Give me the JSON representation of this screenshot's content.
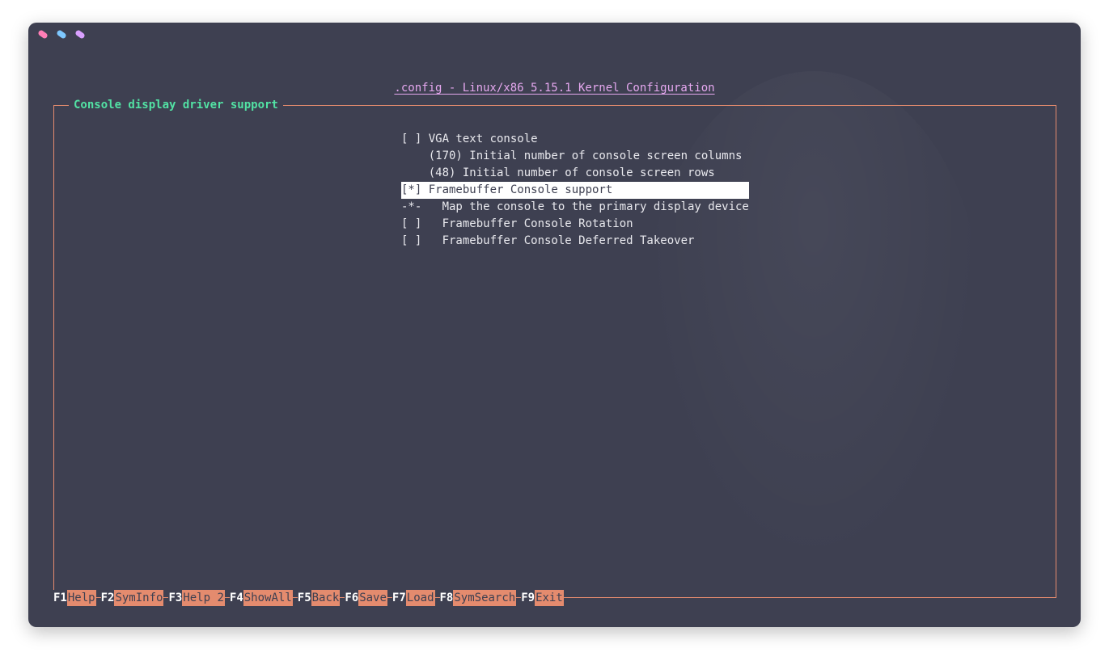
{
  "colors": {
    "window_bg": "#3e4051",
    "accent": "#e48b6e",
    "title_color": "#e6a8f0",
    "frame_title_color": "#52e2a4",
    "text": "#e9e9ee",
    "dot_pink": "#ff7eb6",
    "dot_blue": "#7ec8ff",
    "dot_purple": "#d9a0ff"
  },
  "window_dots": [
    "pink-dot",
    "blue-dot",
    "purple-dot"
  ],
  "title": ".config - Linux/x86 5.15.1 Kernel Configuration",
  "frame_title": "Console display driver support",
  "menu": {
    "items": [
      "[ ] VGA text console",
      "    (170) Initial number of console screen columns",
      "    (48) Initial number of console screen rows",
      "[*] Framebuffer Console support",
      "-*-   Map the console to the primary display device",
      "[ ]   Framebuffer Console Rotation",
      "[ ]   Framebuffer Console Deferred Takeover"
    ],
    "selected_index": 3
  },
  "function_keys": [
    {
      "key": "F1",
      "label": "Help"
    },
    {
      "key": "F2",
      "label": "SymInfo"
    },
    {
      "key": "F3",
      "label": "Help 2"
    },
    {
      "key": "F4",
      "label": "ShowAll"
    },
    {
      "key": "F5",
      "label": "Back"
    },
    {
      "key": "F6",
      "label": "Save"
    },
    {
      "key": "F7",
      "label": "Load"
    },
    {
      "key": "F8",
      "label": "SymSearch"
    },
    {
      "key": "F9",
      "label": "Exit"
    }
  ]
}
